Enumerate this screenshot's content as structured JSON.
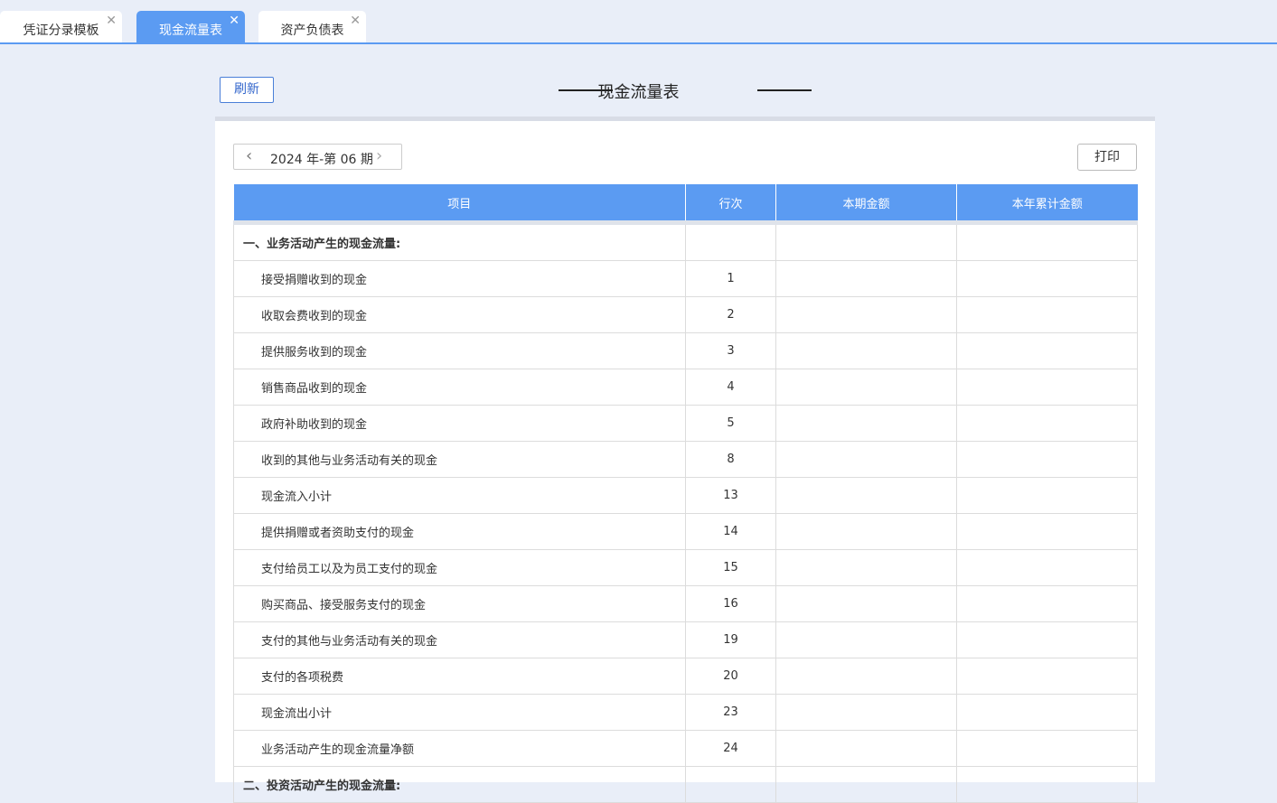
{
  "tabs": [
    {
      "label": "凭证分录模板",
      "close": "✕",
      "active": false
    },
    {
      "label": "现金流量表",
      "close": "✕",
      "active": true
    },
    {
      "label": "资产负债表",
      "close": "✕",
      "active": false
    }
  ],
  "toolbar": {
    "refresh_label": "刷新",
    "print_label": "打印"
  },
  "report": {
    "title": "现金流量表"
  },
  "period": {
    "label": "2024 年-第 06 期",
    "prev_icon": "‹",
    "next_icon": "›"
  },
  "table": {
    "headers": [
      "项目",
      "行次",
      "本期金额",
      "本年累计金额"
    ],
    "rows": [
      {
        "item": "一、业务活动产生的现金流量:",
        "line": "",
        "current": "",
        "ytd": "",
        "section": true
      },
      {
        "item": "接受捐赠收到的现金",
        "line": "1",
        "current": "",
        "ytd": ""
      },
      {
        "item": "收取会费收到的现金",
        "line": "2",
        "current": "",
        "ytd": ""
      },
      {
        "item": "提供服务收到的现金",
        "line": "3",
        "current": "",
        "ytd": ""
      },
      {
        "item": "销售商品收到的现金",
        "line": "4",
        "current": "",
        "ytd": ""
      },
      {
        "item": "政府补助收到的现金",
        "line": "5",
        "current": "",
        "ytd": ""
      },
      {
        "item": "收到的其他与业务活动有关的现金",
        "line": "8",
        "current": "",
        "ytd": ""
      },
      {
        "item": "现金流入小计",
        "line": "13",
        "current": "",
        "ytd": ""
      },
      {
        "item": "提供捐赠或者资助支付的现金",
        "line": "14",
        "current": "",
        "ytd": ""
      },
      {
        "item": "支付给员工以及为员工支付的现金",
        "line": "15",
        "current": "",
        "ytd": ""
      },
      {
        "item": "购买商品、接受服务支付的现金",
        "line": "16",
        "current": "",
        "ytd": ""
      },
      {
        "item": "支付的其他与业务活动有关的现金",
        "line": "19",
        "current": "",
        "ytd": ""
      },
      {
        "item": "支付的各项税费",
        "line": "20",
        "current": "",
        "ytd": ""
      },
      {
        "item": "现金流出小计",
        "line": "23",
        "current": "",
        "ytd": ""
      },
      {
        "item": "业务活动产生的现金流量净额",
        "line": "24",
        "current": "",
        "ytd": ""
      },
      {
        "item": "二、投资活动产生的现金流量:",
        "line": "",
        "current": "",
        "ytd": "",
        "section": true
      }
    ]
  },
  "colors": {
    "accent": "#5b9bf2",
    "background": "#e9eef8"
  }
}
